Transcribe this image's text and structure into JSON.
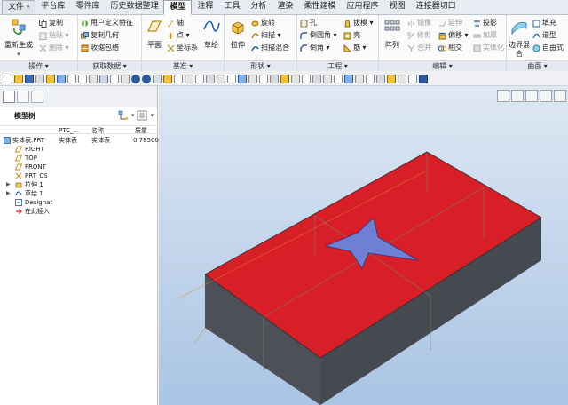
{
  "tabs": [
    {
      "label": "文件",
      "caret": "▾"
    },
    {
      "label": "平台库"
    },
    {
      "label": "零件库"
    },
    {
      "label": "历史数据整理"
    },
    {
      "label": "模型",
      "active": true
    },
    {
      "label": "注释"
    },
    {
      "label": "工具"
    },
    {
      "label": "分析"
    },
    {
      "label": "渲染"
    },
    {
      "label": "柔性建模"
    },
    {
      "label": "应用程序"
    },
    {
      "label": "视图"
    },
    {
      "label": "连接器切口"
    }
  ],
  "ribbon": {
    "operations": {
      "label": "操作 ▾",
      "regenerate": "重新生成",
      "copy": "复制",
      "paste": "粘贴 ▾",
      "delete": "删除 ▾"
    },
    "get_data": {
      "label": "获取数据 ▾",
      "udf": "用户定义特征",
      "copy_geom": "复制几何",
      "shrinkwrap": "收缩包络"
    },
    "datum": {
      "label": "基准 ▾",
      "plane": "平面",
      "axis": "轴",
      "point": "点 ▾",
      "csys": "坐标系",
      "sketch": "草绘"
    },
    "shapes": {
      "label": "形状 ▾",
      "extrude": "拉伸",
      "revolve": "旋转",
      "sweep": "扫描 ▾",
      "swept_blend": "扫描混合"
    },
    "engineering": {
      "label": "工程 ▾",
      "hole": "孔",
      "round": "倒圆角 ▾",
      "chamfer": "倒角 ▾",
      "draft": "拔模 ▾",
      "shell": "壳",
      "rib": "筋 ▾"
    },
    "editing": {
      "label": "编辑 ▾",
      "pattern": "阵列",
      "mirror": "镜像",
      "trim": "修剪",
      "merge": "合并",
      "extend": "延伸",
      "offset": "偏移 ▾",
      "intersect": "相交",
      "project": "投影",
      "thicken": "加厚",
      "solidify": "实体化"
    },
    "surfaces": {
      "label": "曲面 ▾",
      "boundary_blend": "边界混合",
      "fill": "填充",
      "style": "造型",
      "freestyle": "自由式"
    }
  },
  "tree": {
    "title": "模型树",
    "columns": [
      "PTC_...",
      "名称",
      "质量"
    ],
    "rows": [
      {
        "label": "实体表.PRT",
        "c1": "实体表",
        "c2": "实体表",
        "c3": "0.78500",
        "icon": "part-icon"
      },
      {
        "label": "RIGHT",
        "icon": "plane-icon"
      },
      {
        "label": "TOP",
        "icon": "plane-icon"
      },
      {
        "label": "FRONT",
        "icon": "plane-icon"
      },
      {
        "label": "PRT_CS",
        "icon": "csys-icon"
      },
      {
        "label": "拉伸 1",
        "icon": "extrude-icon",
        "expand": "▶"
      },
      {
        "label": "草绘 1",
        "icon": "sketch-icon",
        "expand": "▶"
      },
      {
        "label": "Designat",
        "icon": "designate-icon"
      },
      {
        "label": "在此插入",
        "icon": "insert-here-icon"
      }
    ]
  },
  "colors": {
    "top_face": "#d81e26",
    "side_face": "#4d5157",
    "star": "#6f7fd3",
    "accent": "#2a5b9a"
  }
}
